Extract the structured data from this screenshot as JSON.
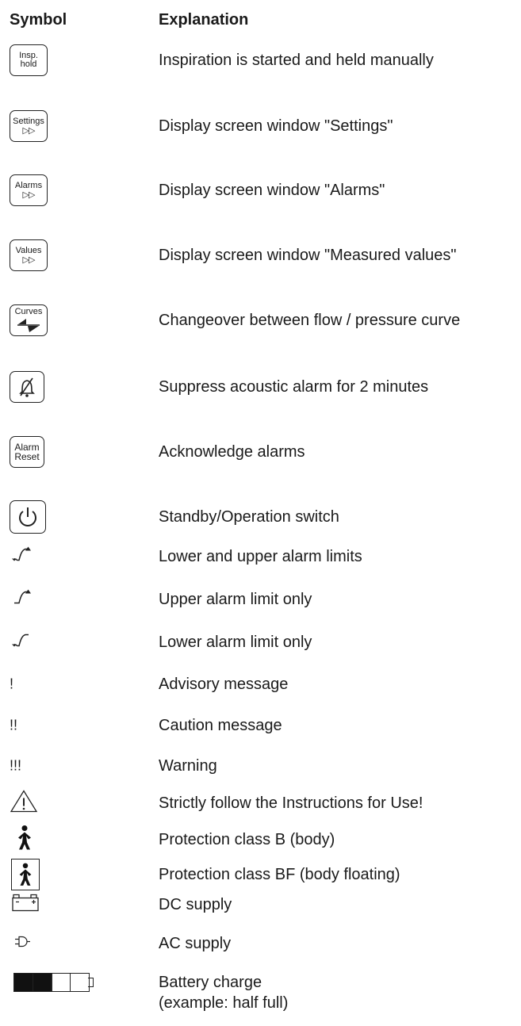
{
  "headers": {
    "symbol": "Symbol",
    "explanation": "Explanation"
  },
  "rows": [
    {
      "icon": "insp-hold-key-icon",
      "key_label_1": "Insp.",
      "key_label_2": "hold",
      "text": "Inspiration is started and held manually"
    },
    {
      "icon": "settings-key-icon",
      "key_label_1": "Settings",
      "key_arrows": "▷▷",
      "text": "Display screen window \"Settings\""
    },
    {
      "icon": "alarms-key-icon",
      "key_label_1": "Alarms",
      "key_arrows": "▷▷",
      "text": "Display screen window \"Alarms\""
    },
    {
      "icon": "values-key-icon",
      "key_label_1": "Values",
      "key_arrows": "▷▷",
      "text": "Display screen window \"Measured values\""
    },
    {
      "icon": "curves-key-icon",
      "key_label_1": "Curves",
      "text": "Changeover between flow / pressure curve"
    },
    {
      "icon": "alarm-silence-key-icon",
      "text": "Suppress acoustic alarm for 2 minutes"
    },
    {
      "icon": "alarm-reset-key-icon",
      "key_label_1": "Alarm",
      "key_label_2": "Reset",
      "text": "Acknowledge alarms"
    },
    {
      "icon": "power-standby-icon",
      "text": "Standby/Operation switch"
    },
    {
      "icon": "lower-upper-alarm-limit-icon",
      "text": "Lower and upper alarm limits"
    },
    {
      "icon": "upper-alarm-limit-icon",
      "text": "Upper alarm limit only"
    },
    {
      "icon": "lower-alarm-limit-icon",
      "text": "Lower alarm limit only"
    },
    {
      "icon": "advisory-icon",
      "glyph": "!",
      "text": "Advisory message"
    },
    {
      "icon": "caution-icon",
      "glyph": "!!",
      "text": "Caution message"
    },
    {
      "icon": "warning-icon",
      "glyph": "!!!",
      "text": "Warning"
    },
    {
      "icon": "attention-triangle-icon",
      "text": "Strictly follow the Instructions for Use!"
    },
    {
      "icon": "body-type-b-icon",
      "text": "Protection class B (body)"
    },
    {
      "icon": "body-floating-bf-icon",
      "text": "Protection class BF (body floating)"
    },
    {
      "icon": "dc-battery-icon",
      "text": "DC supply"
    },
    {
      "icon": "ac-plug-icon",
      "text": "AC supply"
    },
    {
      "icon": "battery-charge-icon",
      "battery_level": 0.5,
      "text_line_1": "Battery charge",
      "text_line_2": "(example: half full)"
    }
  ]
}
